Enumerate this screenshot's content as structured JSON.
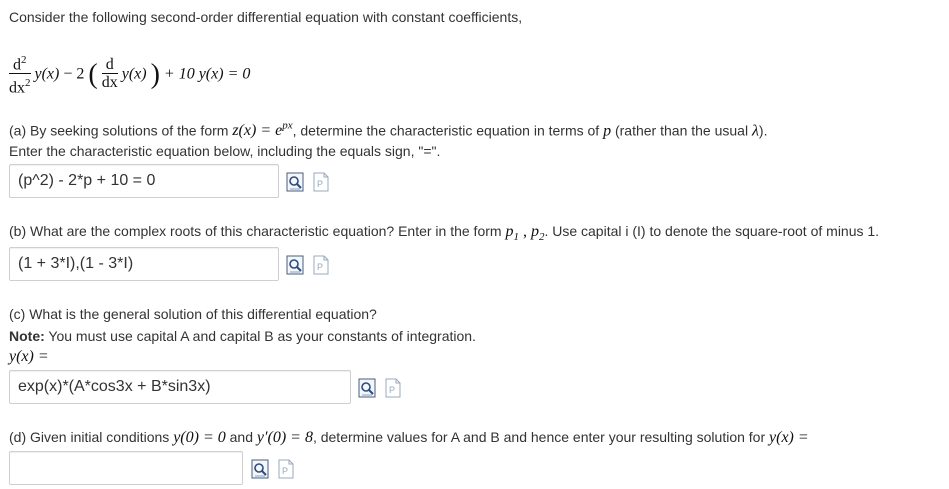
{
  "intro": "Consider the following second-order differential equation with constant coefficients,",
  "equation": {
    "d2_num": "d",
    "d2_num_sup": "2",
    "d2_den": "dx",
    "d2_den_sup": "2",
    "y_of_x": "y(x)",
    "minus_two": "− 2",
    "d1_num": "d",
    "d1_den": "dx",
    "tail": "+ 10 y(x) = 0"
  },
  "part_a": {
    "text_1": "(a) By seeking solutions of the form ",
    "form_math": "z(x) = e",
    "form_sup": "px",
    "text_2": ", determine the characteristic equation in terms of ",
    "p_math": "p",
    "text_3": " (rather than the usual ",
    "lambda_math": "λ",
    "text_4": ").",
    "line2": "Enter the characteristic equation below, including the equals sign, \"=\".",
    "answer": "(p^2) - 2*p + 10 = 0"
  },
  "part_b": {
    "text_1": "(b) What are the complex roots of this characteristic equation? Enter in the form ",
    "roots_math": "p",
    "sub1": "1",
    "comma": " , ",
    "roots_math2": "p",
    "sub2": "2",
    "text_2": ". Use capital i (I) to denote the square-root of minus 1.",
    "answer": "(1 + 3*I),(1 -  3*I)"
  },
  "part_c": {
    "text_1": "(c) What is the general solution of this differential equation?",
    "note_bold": "Note:",
    "note_text": " You must use capital A and capital B as your constants of integration.",
    "y_label": "y(x) =",
    "answer": "exp(x)*(A*cos3x + B*sin3x)"
  },
  "part_d": {
    "text_1": "(d) Given initial conditions ",
    "ic1": "y(0) = 0",
    "and": " and ",
    "ic2": "y′(0) = 8",
    "text_2": ", determine values for A and B and hence enter your resulting solution for ",
    "y_eq": "y(x) =",
    "answer": ""
  },
  "icons": {
    "preview": "preview-icon",
    "file": "file-icon"
  }
}
